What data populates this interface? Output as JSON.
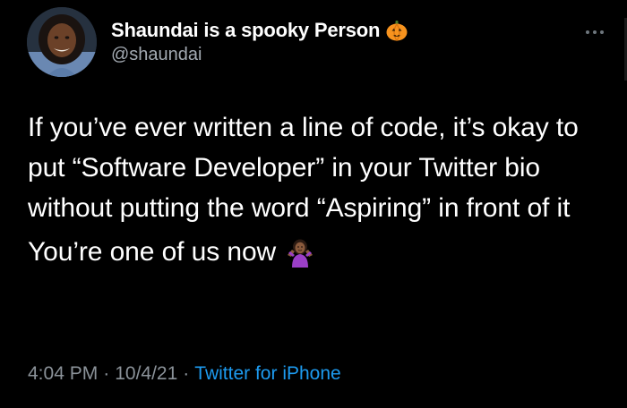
{
  "tweet": {
    "author": {
      "display_name": "Shaundai is a spooky Person",
      "name_emoji": "pumpkin-icon",
      "handle": "@shaundai",
      "avatar": "avatar"
    },
    "more_icon": "more-horizontal-icon",
    "text_paragraph_1": "If you’ve ever written a line of code, it’s okay to put “Software Developer” in your Twitter bio without putting the word “Aspiring” in front of it",
    "text_paragraph_2": "You’re one of us now",
    "text_paragraph_2_emoji": "person-shrugging-icon",
    "time": "4:04 PM",
    "separator": "·",
    "date": "10/4/21",
    "source": "Twitter for iPhone"
  },
  "colors": {
    "background": "#000000",
    "text_primary": "#ffffff",
    "text_secondary": "#8b9299",
    "link": "#1d9bf0",
    "pumpkin": "#f7931e"
  }
}
